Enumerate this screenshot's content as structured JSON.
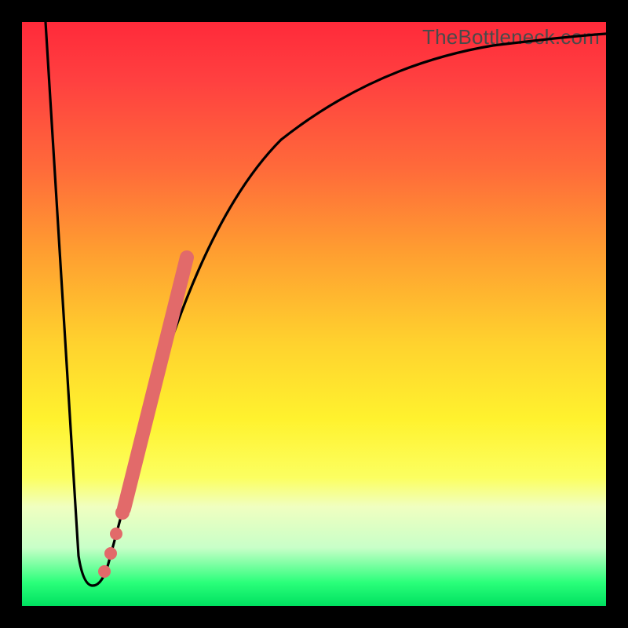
{
  "watermark": "TheBottleneck.com",
  "chart_data": {
    "type": "line",
    "title": "",
    "xlabel": "",
    "ylabel": "",
    "xlim": [
      0,
      100
    ],
    "ylim": [
      0,
      100
    ],
    "grid": false,
    "legend": false,
    "series": [
      {
        "name": "bottleneck-curve",
        "color": "#000000",
        "x": [
          0,
          6,
          9,
          10,
          11,
          13,
          15,
          17,
          20,
          23,
          26,
          30,
          35,
          42,
          52,
          65,
          80,
          95,
          100
        ],
        "y": [
          100,
          55,
          8,
          4,
          4,
          6,
          12,
          22,
          35,
          48,
          58,
          67,
          75,
          82,
          88,
          92,
          95,
          96.5,
          97
        ]
      }
    ],
    "highlight_segment": {
      "name": "marker-stroke",
      "color": "#e26a6a",
      "x": [
        15,
        17,
        20,
        23,
        26,
        30
      ],
      "y": [
        12,
        22,
        35,
        48,
        58,
        67
      ]
    },
    "highlight_dots": {
      "name": "marker-dots",
      "color": "#e26a6a",
      "points": [
        {
          "x": 13,
          "y": 6
        },
        {
          "x": 15,
          "y": 12
        },
        {
          "x": 16,
          "y": 17
        },
        {
          "x": 17,
          "y": 22
        }
      ]
    },
    "gradient_stops": [
      {
        "pos": 0,
        "color": "#ff2a3a"
      },
      {
        "pos": 25,
        "color": "#ff6a3a"
      },
      {
        "pos": 55,
        "color": "#ffd22e"
      },
      {
        "pos": 78,
        "color": "#fcff60"
      },
      {
        "pos": 96,
        "color": "#2aff7a"
      },
      {
        "pos": 100,
        "color": "#00e060"
      }
    ]
  }
}
